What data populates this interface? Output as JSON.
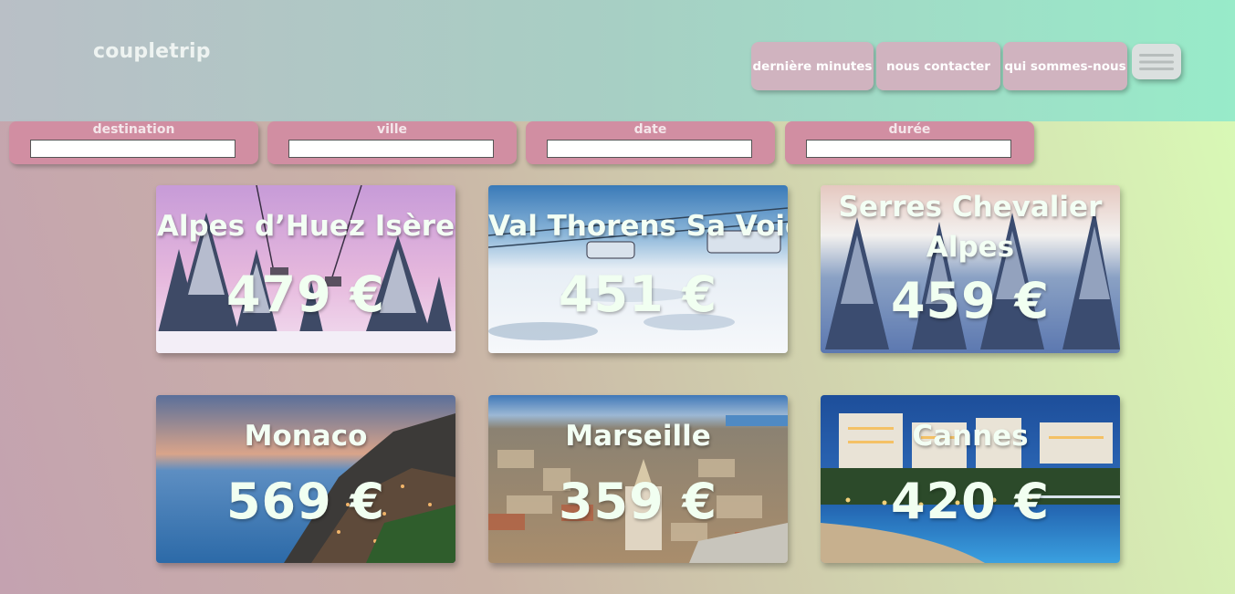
{
  "brand": {
    "logo": "coupletrip"
  },
  "nav": {
    "items": [
      {
        "label": "dernière minutes"
      },
      {
        "label": "nous contacter"
      },
      {
        "label": "qui sommes-nous"
      }
    ],
    "menu_icon": "hamburger-icon"
  },
  "filters": [
    {
      "label": "destination",
      "value": ""
    },
    {
      "label": "ville",
      "value": ""
    },
    {
      "label": "date",
      "value": ""
    },
    {
      "label": "durée",
      "value": ""
    }
  ],
  "cards": [
    {
      "title": "Alpes d’Huez Isère",
      "price": "479 €"
    },
    {
      "title": "Val Thorens Sa Voie",
      "price": "451 €"
    },
    {
      "title_line1": "Serres Chevalier",
      "title_line2": "Alpes",
      "price": "459 €"
    },
    {
      "title": "Monaco",
      "price": "569 €"
    },
    {
      "title": "Marseille",
      "price": "359 €"
    },
    {
      "title": "Cannes",
      "price": "420 €"
    }
  ],
  "colors": {
    "nav_button": "#d0b3bf",
    "filter_box": "#d18ea2",
    "card_text": "#f3fff4"
  }
}
